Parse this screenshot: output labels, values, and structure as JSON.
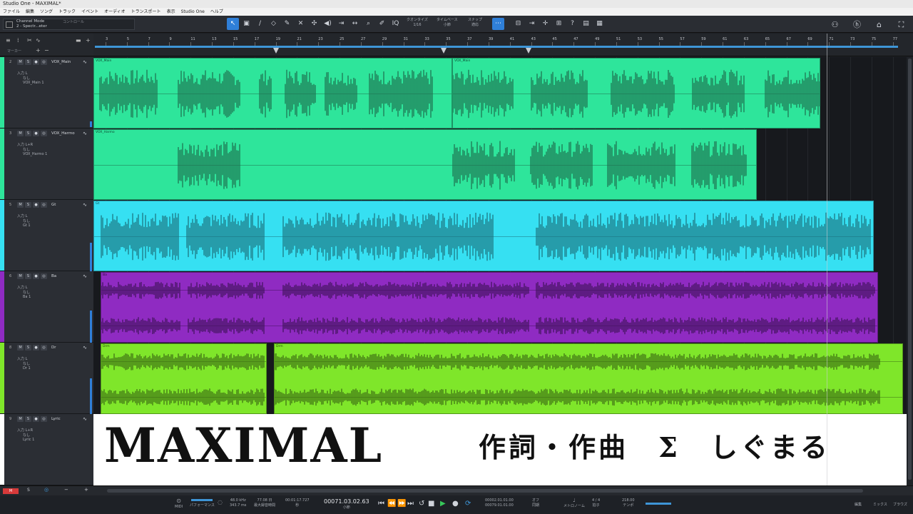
{
  "window": {
    "title": "Studio One - MAXIMAL*"
  },
  "menu": [
    "ファイル",
    "編集",
    "ソング",
    "トラック",
    "イベント",
    "オーディオ",
    "トランスポート",
    "表示",
    "Studio One",
    "ヘルプ"
  ],
  "toolbar": {
    "channel_mode": "Channel Mode",
    "channel_sub": "2 - Spectr...eter",
    "control_label": "コントロール",
    "quantize_label": "クオンタイズ",
    "quantize_value": "1/16",
    "timebase_label": "タイムベース",
    "timebase_value": "小節",
    "snap_label": "スナップ",
    "snap_value": "適応",
    "iq_label": "IQ"
  },
  "ruler": {
    "bars": [
      "3",
      "5",
      "7",
      "9",
      "11",
      "13",
      "15",
      "17",
      "19",
      "21",
      "23",
      "25",
      "27",
      "29",
      "31",
      "33",
      "35",
      "37",
      "39",
      "41",
      "43",
      "45",
      "47",
      "49",
      "51",
      "53",
      "55",
      "57",
      "59",
      "61",
      "63",
      "65",
      "67",
      "69",
      "71",
      "73",
      "75",
      "77"
    ],
    "marker_label": "マーカー"
  },
  "tracks": [
    {
      "num": "2",
      "name": "VOX_Main",
      "in": "入力 L",
      "mid": "なし",
      "out": "VOX_Main 1",
      "color": "#2ee59b"
    },
    {
      "num": "3",
      "name": "VOX_Harmo",
      "in": "入力 L+R",
      "mid": "なし",
      "out": "VOX_Harmo 1",
      "color": "#2ee59b"
    },
    {
      "num": "5",
      "name": "Gt",
      "in": "入力 L",
      "mid": "なし",
      "out": "Gt 1",
      "color": "#36e0f2"
    },
    {
      "num": "6",
      "name": "Ba",
      "in": "入力 L",
      "mid": "なし",
      "out": "Ba 1",
      "color": "#8f2bc2"
    },
    {
      "num": "8",
      "name": "Dr",
      "in": "入力 L",
      "mid": "なし",
      "out": "Dr 1",
      "color": "#7fe62a"
    },
    {
      "num": "9",
      "name": "Lyric",
      "in": "入力 L+R",
      "mid": "なし",
      "out": "Lyric 1",
      "color": "#ffffff"
    }
  ],
  "clips": {
    "vox_main_a": "VOX_Main",
    "vox_main_b": "VOX_Main",
    "vox_harmo": "VOX_Harmo",
    "gt": "Gt",
    "ba": "Ba",
    "dr_a": "Drm",
    "dr_b": "Drm"
  },
  "lyric": {
    "title": "MAXIMAL",
    "credit": "作詞・作曲　Σ　しぐまる"
  },
  "transport": {
    "midi": "MIDI",
    "performance": "パフォーマンス",
    "sample_rate": "48.0 kHz",
    "latency": "343.7 ms",
    "days": "77.08 日",
    "days_label": "最大録音時間",
    "time_sec": "00:01:17.727",
    "time_sec_label": "秒",
    "position": "00071.03.02.63",
    "position_label": "小節",
    "loop_l": "00002.01.01.00",
    "loop_r": "00079.01.01.00",
    "off": "オフ",
    "sync": "同期",
    "metronome": "メトロノーム",
    "signature": "4 / 4",
    "signature_label": "拍子",
    "tempo": "218.00",
    "tempo_label": "テンポ",
    "edit": "編集",
    "mix": "ミックス",
    "browse": "ブラウズ"
  }
}
